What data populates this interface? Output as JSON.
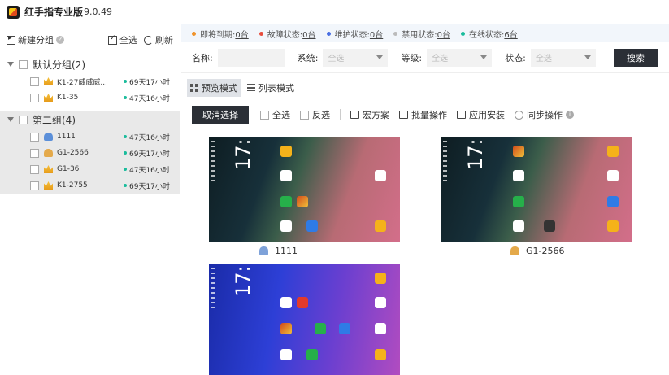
{
  "app": {
    "title": "红手指专业版",
    "version": "9.0.49"
  },
  "left_toolbar": {
    "new_group": "新建分组",
    "select_all": "全选",
    "refresh": "刷新"
  },
  "groups": [
    {
      "name": "默认分组(2)",
      "devices": [
        {
          "name": "K1-27威威威...",
          "time": "69天17小时",
          "icon": "crown-icon"
        },
        {
          "name": "K1-35",
          "time": "47天16小时",
          "icon": "crown-icon"
        }
      ]
    },
    {
      "name": "第二组(4)",
      "devices": [
        {
          "name": "1111",
          "time": "47天16小时",
          "icon": "android-icon"
        },
        {
          "name": "G1-2566",
          "time": "69天17小时",
          "icon": "android-icon"
        },
        {
          "name": "G1-36",
          "time": "47天16小时",
          "icon": "crown-icon"
        },
        {
          "name": "K1-2755",
          "time": "69天17小时",
          "icon": "crown-icon"
        }
      ]
    }
  ],
  "status": [
    {
      "label": "即将到期:",
      "value": "0台",
      "color": "#f0932b"
    },
    {
      "label": "故障状态:",
      "value": "0台",
      "color": "#e74c3c"
    },
    {
      "label": "维护状态:",
      "value": "0台",
      "color": "#4a6fe3"
    },
    {
      "label": "禁用状态:",
      "value": "0台",
      "color": "#bbbbbb"
    },
    {
      "label": "在线状态:",
      "value": "6台",
      "color": "#1abc9c"
    }
  ],
  "filter": {
    "name_label": "名称:",
    "system_label": "系统:",
    "level_label": "等级:",
    "state_label": "状态:",
    "select_placeholder": "全选",
    "search_button": "搜索"
  },
  "modes": {
    "preview": "预览模式",
    "list": "列表模式"
  },
  "actions": {
    "cancel_select": "取消选择",
    "select_all": "全选",
    "invert": "反选",
    "macro": "宏方案",
    "batch": "批量操作",
    "install": "应用安装",
    "sync": "同步操作"
  },
  "phones": [
    {
      "label": "1111",
      "clock": "17:51"
    },
    {
      "label": "G1-2566",
      "clock": "17:51"
    },
    {
      "label": "",
      "clock": "17:51"
    }
  ]
}
